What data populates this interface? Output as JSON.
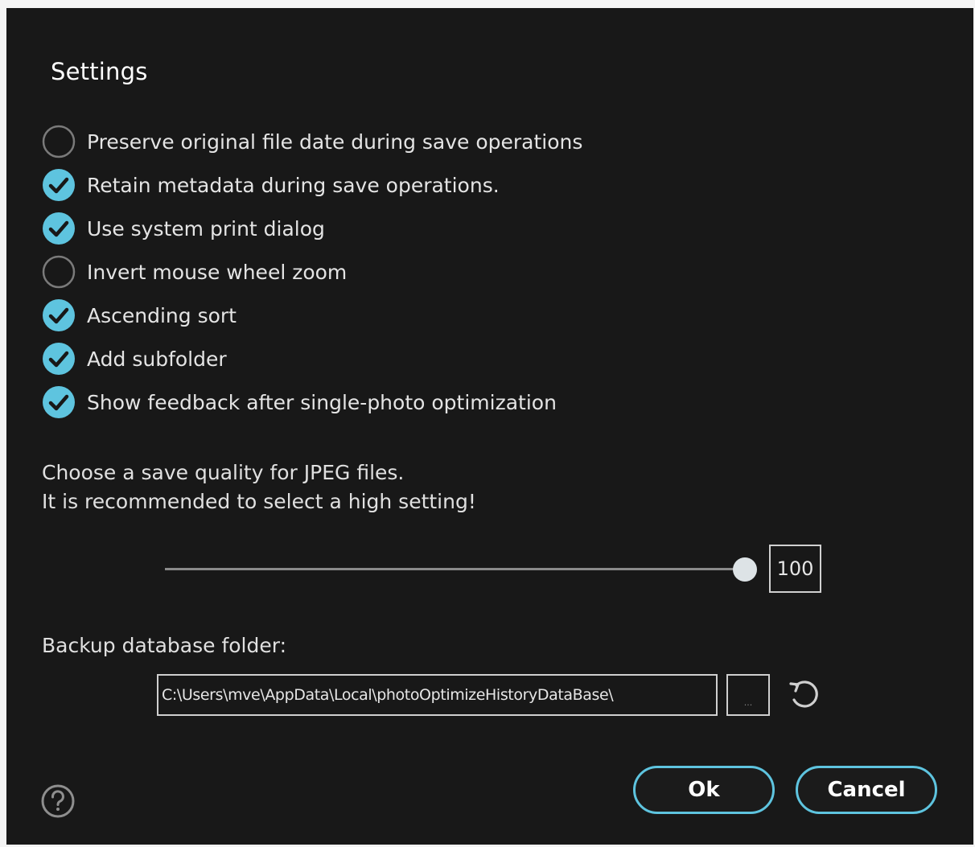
{
  "dialog": {
    "title": "Settings"
  },
  "options": [
    {
      "label": "Preserve original file date during save operations",
      "checked": false
    },
    {
      "label": "Retain metadata during save operations.",
      "checked": true
    },
    {
      "label": "Use system print dialog",
      "checked": true
    },
    {
      "label": "Invert mouse wheel zoom",
      "checked": false
    },
    {
      "label": "Ascending sort",
      "checked": true
    },
    {
      "label": "Add subfolder",
      "checked": true
    },
    {
      "label": "Show feedback after single-photo optimization",
      "checked": true
    }
  ],
  "quality": {
    "line1": "Choose a save quality for JPEG files.",
    "line2": "It is recommended to select a high setting!",
    "value": "100",
    "max": 100
  },
  "backup": {
    "label": "Backup database folder:",
    "path": "C:\\Users\\mve\\AppData\\Local\\photoOptimizeHistoryDataBase\\",
    "browse_label": "..."
  },
  "buttons": {
    "ok_label": "Ok",
    "cancel_label": "Cancel"
  },
  "icons": {
    "help": "question-circle-icon",
    "reset": "undo-arrow-icon",
    "checked": "check-circle-icon",
    "unchecked": "empty-circle-icon"
  },
  "colors": {
    "accent": "#5ec4df",
    "background": "#181818"
  }
}
